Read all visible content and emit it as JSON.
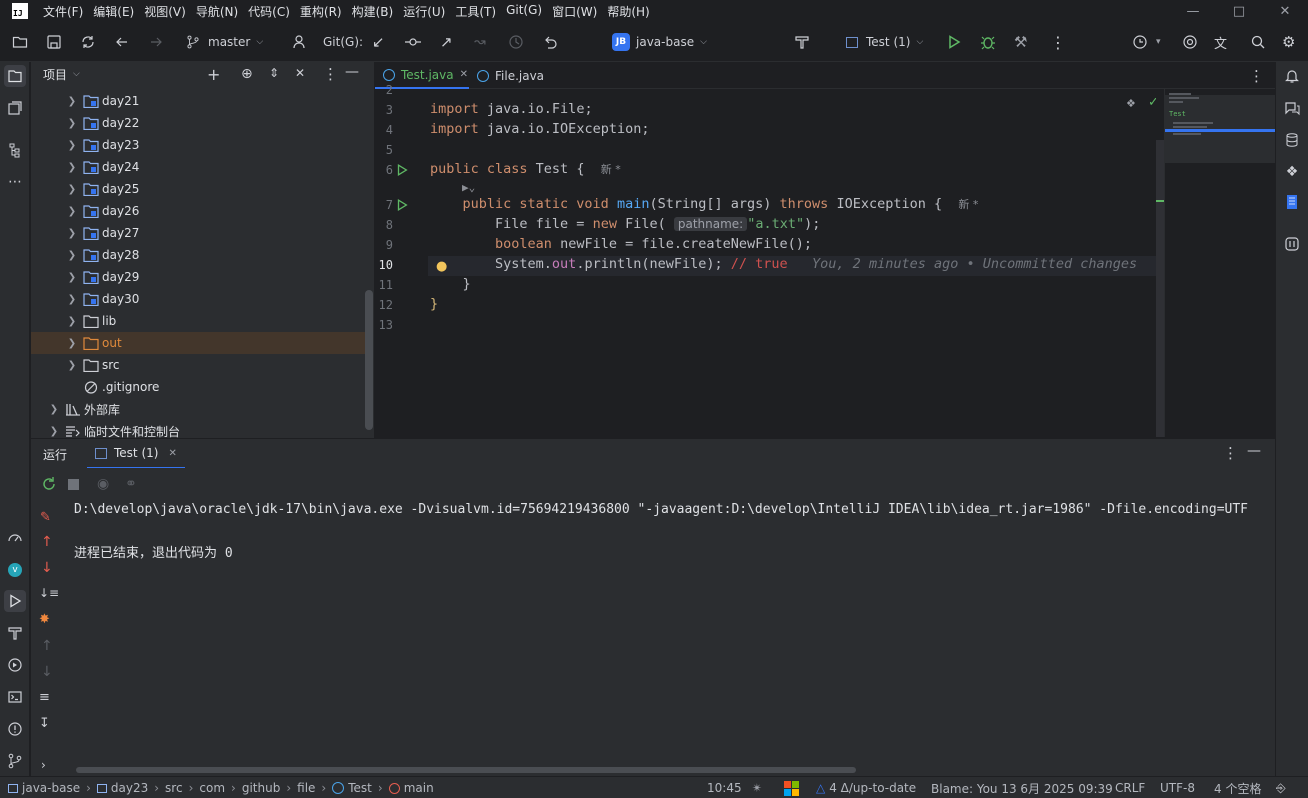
{
  "menu": {
    "items": [
      "文件(F)",
      "编辑(E)",
      "视图(V)",
      "导航(N)",
      "代码(C)",
      "重构(R)",
      "构建(B)",
      "运行(U)",
      "工具(T)",
      "Git(G)",
      "窗口(W)",
      "帮助(H)"
    ]
  },
  "toolbar": {
    "branch": "master",
    "git_label": "Git(G):",
    "project_badge": "JB",
    "project_name": "java-base",
    "run_config": "Test (1)"
  },
  "project_panel": {
    "title": "项目",
    "items": [
      {
        "label": "day21",
        "type": "module"
      },
      {
        "label": "day22",
        "type": "module"
      },
      {
        "label": "day23",
        "type": "module"
      },
      {
        "label": "day24",
        "type": "module"
      },
      {
        "label": "day25",
        "type": "module"
      },
      {
        "label": "day26",
        "type": "module"
      },
      {
        "label": "day27",
        "type": "module"
      },
      {
        "label": "day28",
        "type": "module"
      },
      {
        "label": "day29",
        "type": "module"
      },
      {
        "label": "day30",
        "type": "module"
      },
      {
        "label": "lib",
        "type": "folder"
      },
      {
        "label": "out",
        "type": "folder-excluded"
      },
      {
        "label": "src",
        "type": "folder"
      },
      {
        "label": ".gitignore",
        "type": "ignore-file"
      },
      {
        "label": "外部库",
        "type": "library"
      },
      {
        "label": "临时文件和控制台",
        "type": "scratch"
      }
    ]
  },
  "editor": {
    "tabs": [
      {
        "label": "Test.java",
        "active": true
      },
      {
        "label": "File.java",
        "active": false
      }
    ],
    "line_numbers": [
      "2",
      "3",
      "4",
      "5",
      "6",
      "7",
      "8",
      "9",
      "10",
      "11",
      "12",
      "13"
    ],
    "hint_param": "pathname:",
    "new_marker": "新 *",
    "ai_comment": "// true",
    "blame_inline": "You, 2 minutes ago • Uncommitted changes",
    "minimap_label": "Test"
  },
  "run_panel": {
    "title": "运行",
    "tab": "Test (1)",
    "console_lines": [
      "D:\\develop\\java\\oracle\\jdk-17\\bin\\java.exe -Dvisualvm.id=75694219436800 \"-javaagent:D:\\develop\\IntelliJ IDEA\\lib\\idea_rt.jar=1986\" -Dfile.encoding=UTF",
      "进程已结束，退出代码为 0"
    ]
  },
  "status_bar": {
    "breadcrumbs": [
      "java-base",
      "day23",
      "src",
      "com",
      "github",
      "file",
      "Test",
      "main"
    ],
    "time": "10:45",
    "vcs": "4 Δ/up-to-date",
    "blame": "Blame: You 13 6月 2025 09:39",
    "line_sep": "CRLF",
    "encoding": "UTF-8",
    "indent": "4 个空格"
  },
  "colors": {
    "accent": "#3574f0",
    "keyword": "#cf8e6d",
    "function": "#56a8f5",
    "string": "#6aab73",
    "run_green": "#5fb865"
  }
}
